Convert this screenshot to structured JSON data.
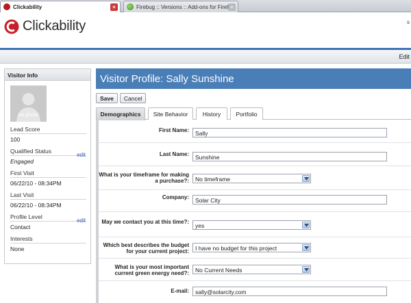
{
  "browser": {
    "tabs": [
      {
        "title": "Clickability",
        "active": true
      },
      {
        "title": "Firebug :: Versions :: Add-ons for Firefox",
        "active": false
      }
    ],
    "close_glyph": "×"
  },
  "app": {
    "brand": "Clickability",
    "brand_color": "#c8202a",
    "corner_mark": "s",
    "subbar_edit_label": "Edit"
  },
  "visitor_info": {
    "title": "Visitor Info",
    "photo_placeholder": "no photo",
    "edit_label": "edit",
    "fields": [
      {
        "label": "Lead Score",
        "value": "100",
        "editable": false
      },
      {
        "label": "Qualified Status",
        "value": "Engaged",
        "editable": true
      },
      {
        "label": "First Visit",
        "value": "06/22/10 - 08:34PM",
        "editable": false
      },
      {
        "label": "Last Visit",
        "value": "06/22/10 - 08:34PM",
        "editable": false
      },
      {
        "label": "Profile Level",
        "value": "Contact",
        "editable": true
      },
      {
        "label": "Interests",
        "value": "None",
        "editable": false
      }
    ]
  },
  "profile": {
    "title": "Visitor Profile: Sally Sunshine",
    "accent": "#4a7eb7",
    "actions": {
      "save": "Save",
      "cancel": "Cancel"
    },
    "tabs": [
      "Demographics",
      "Site Behavior",
      "History",
      "Portfolio"
    ],
    "active_tab": "Demographics",
    "form": [
      {
        "label": "First Name:",
        "type": "text",
        "value": "Sally"
      },
      {
        "label": "Last Name:",
        "type": "text",
        "value": "Sunshine"
      },
      {
        "label": "What is your timeframe for making a purchase?:",
        "type": "select",
        "value": "No timeframe"
      },
      {
        "label": "Company:",
        "type": "text",
        "value": "Solar City"
      },
      {
        "label": "May we contact you at this time?:",
        "type": "select",
        "value": "yes"
      },
      {
        "label": "Which best describes the budget for your current project:",
        "type": "select",
        "value": "I have no budget for this project"
      },
      {
        "label": "What is your most important current green energy need?:",
        "type": "select",
        "value": "No Current Needs"
      },
      {
        "label": "E-mail:",
        "type": "text",
        "value": "sally@solarcity.com"
      }
    ]
  }
}
